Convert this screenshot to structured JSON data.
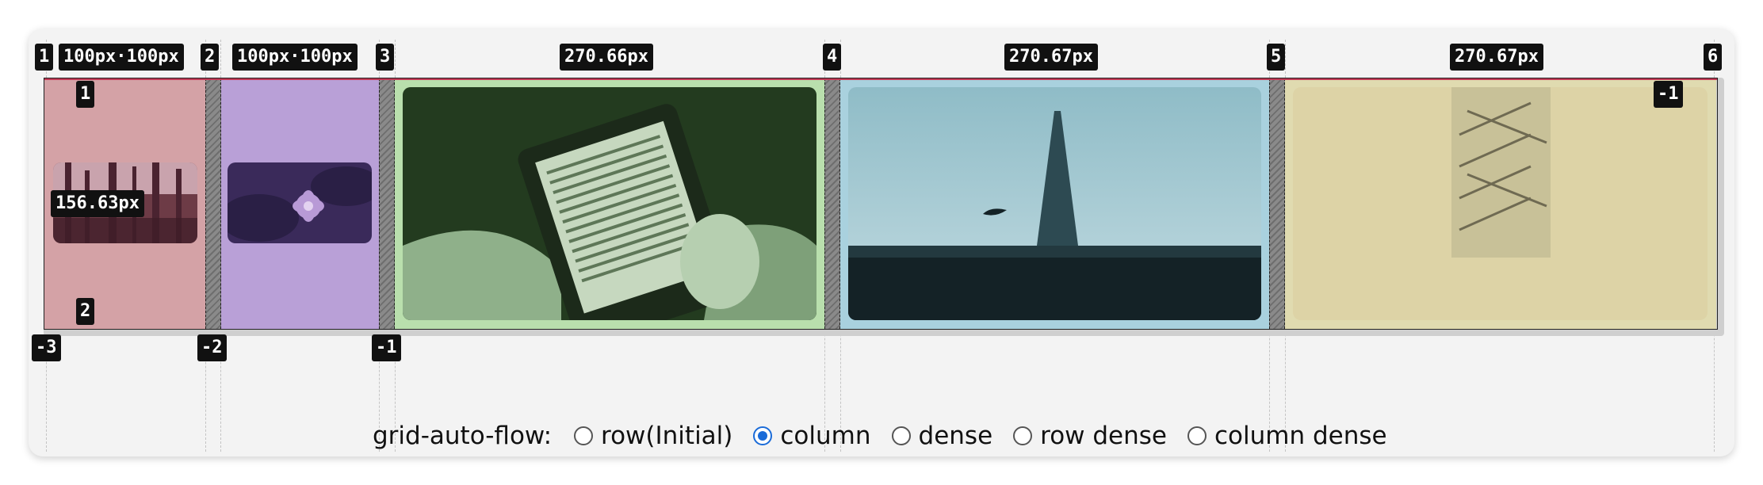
{
  "grid": {
    "line_numbers_top": [
      "1",
      "2",
      "3",
      "4",
      "5",
      "6"
    ],
    "line_numbers_bottom": [
      "-3",
      "-2",
      "-1"
    ],
    "track_sizes": [
      "100px·100px",
      "100px·100px",
      "270.66px",
      "270.67px",
      "270.67px"
    ],
    "row_labels": [
      "1",
      "2"
    ],
    "row_end_label": "-1",
    "row_height_label": "156.63px"
  },
  "controls": {
    "label": "grid-auto-flow:",
    "options": [
      {
        "label": "row(Initial)",
        "selected": false
      },
      {
        "label": "column",
        "selected": true
      },
      {
        "label": "dense",
        "selected": false
      },
      {
        "label": "row dense",
        "selected": false
      },
      {
        "label": "column dense",
        "selected": false
      }
    ]
  },
  "colors": {
    "track1": "#d4a2a6",
    "track2": "#b9a0d7",
    "track3": "#b9dfad",
    "track4": "#a9d1de",
    "track5": "#e0dbb0",
    "line_red": "#c23a55",
    "radio_accent": "#1a6bd8"
  },
  "icons": [
    "forest-photo",
    "water-lily-photo",
    "ebook-reader-photo",
    "eiffel-tower-photo",
    "staircase-photo"
  ]
}
